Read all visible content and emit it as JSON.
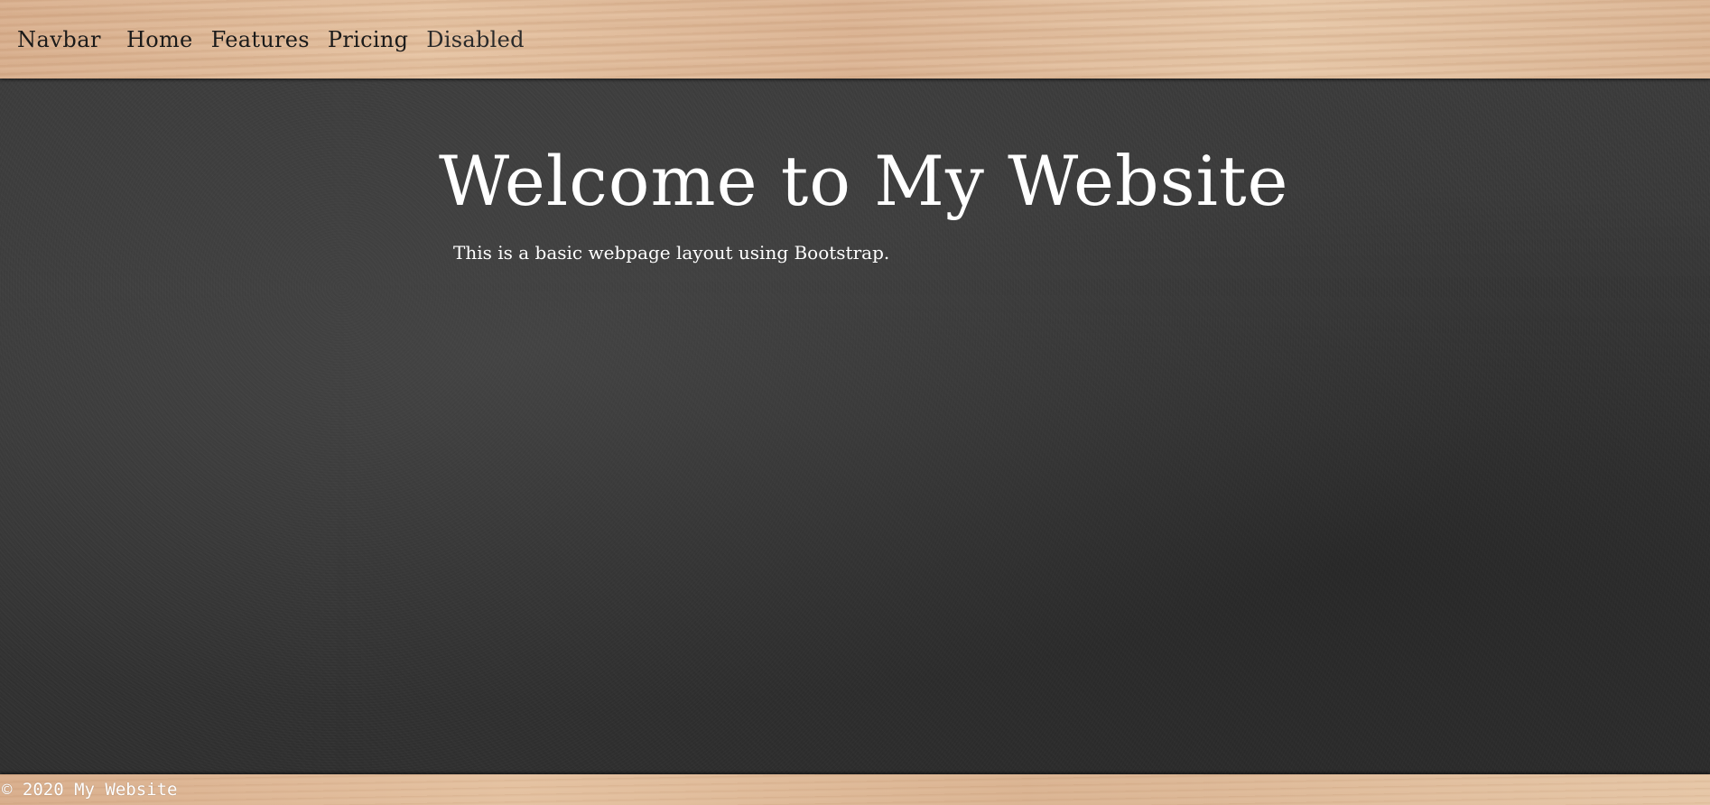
{
  "navbar": {
    "brand": "Navbar",
    "links": [
      {
        "label": "Home"
      },
      {
        "label": "Features"
      },
      {
        "label": "Pricing"
      },
      {
        "label": "Disabled"
      }
    ]
  },
  "hero": {
    "title": "Welcome to My Website",
    "text": "This is a basic webpage layout using Bootstrap."
  },
  "footer": {
    "text": "© 2020 My Website"
  },
  "colors": {
    "navbar_wood": "#e3bf9e",
    "chalkboard": "#3a3a3a",
    "hero_text": "#ffffff",
    "nav_text": "#1a1a1a"
  }
}
